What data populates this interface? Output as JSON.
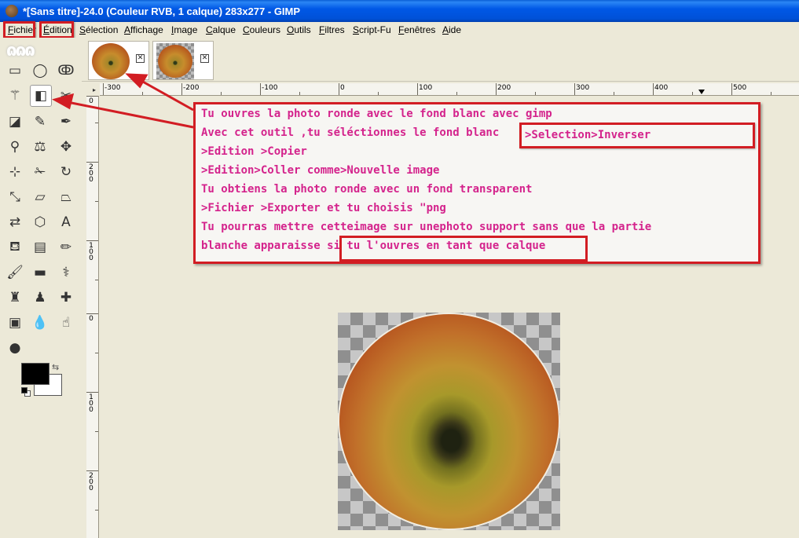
{
  "window": {
    "title": "*[Sans titre]-24.0 (Couleur RVB, 1 calque) 283x277 - GIMP"
  },
  "menubar": {
    "items": [
      "Fichier",
      "Édition",
      "Sélection",
      "Affichage",
      "Image",
      "Calque",
      "Couleurs",
      "Outils",
      "Filtres",
      "Script-Fu",
      "Fenêtres",
      "Aide"
    ]
  },
  "toolbox": {
    "tools": [
      "rectangle-select",
      "ellipse-select",
      "free-select",
      "fuzzy-select",
      "select-by-color",
      "scissors",
      "foreground-select",
      "paths",
      "color-picker",
      "zoom",
      "measure",
      "move",
      "align",
      "crop",
      "rotate",
      "scale",
      "shear",
      "perspective",
      "flip",
      "cage-transform",
      "text",
      "bucket-fill",
      "blend",
      "pencil",
      "paintbrush",
      "eraser",
      "airbrush",
      "ink",
      "clone",
      "heal",
      "perspective-clone",
      "blur",
      "smudge",
      "dodge-burn"
    ],
    "foreground": "#000000",
    "background": "#ffffff"
  },
  "ruler": {
    "h_labels": [
      "-300",
      "-200",
      "-100",
      "0",
      "100",
      "200",
      "300",
      "400",
      "500"
    ],
    "v_labels": [
      [
        "0"
      ],
      [
        "2",
        "0",
        "0"
      ],
      [
        "1",
        "0",
        "0"
      ],
      [
        "0"
      ],
      [
        "1",
        "0",
        "0"
      ],
      [
        "2",
        "0",
        "0"
      ]
    ]
  },
  "annotation": {
    "lines": [
      "Tu ouvres la photo ronde avec le fond blanc avec gimp",
      "Avec cet outil ,tu séléctionnes le fond blanc",
      ">Edition >Copier",
      ">Edition>Coller comme>Nouvelle image",
      "Tu obtiens la photo ronde avec un fond transparent",
      ">Fichier >Exporter et tu choisis \"png",
      "Tu pourras mettre cetteimage sur unephoto support sans que la partie",
      "blanche apparaisse si tu l'ouvres en tant que calque"
    ],
    "selection_note": ">Selection>Inverser"
  },
  "colors": {
    "annotation_text": "#d4238c",
    "highlight_border": "#d21d23",
    "titlebar": "#0058e6"
  }
}
